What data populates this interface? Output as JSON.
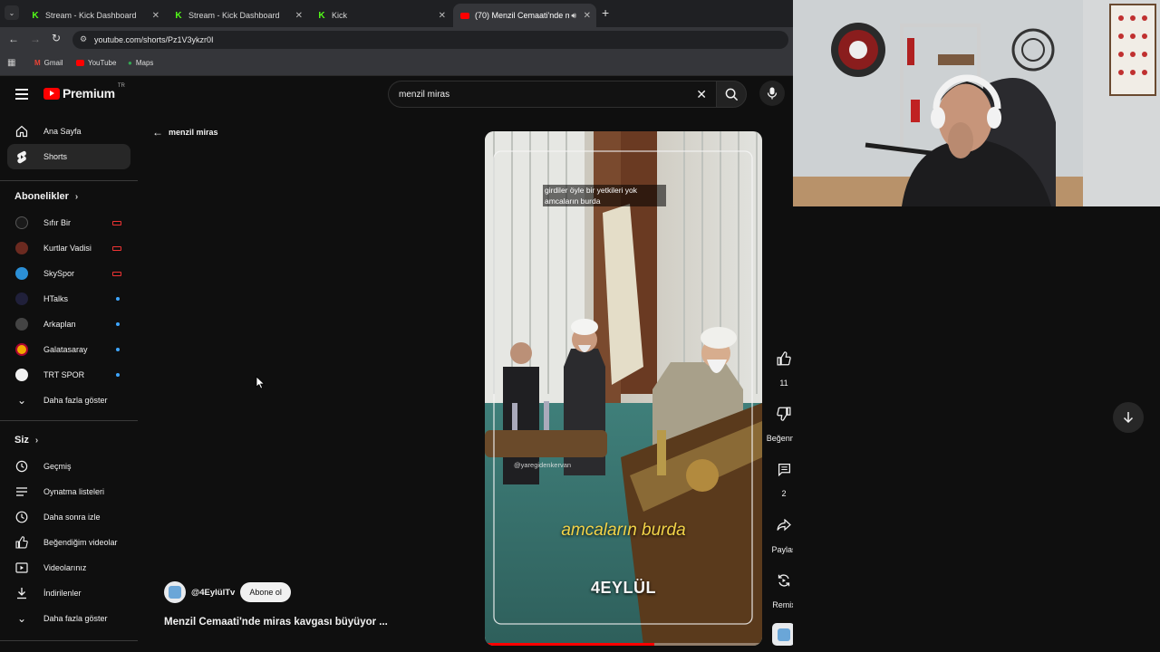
{
  "browser": {
    "tabs": [
      {
        "label": "Stream - Kick Dashboard"
      },
      {
        "label": "Stream - Kick Dashboard"
      },
      {
        "label": "Kick"
      },
      {
        "label": "(70) Menzil Cemaati'nde m"
      }
    ],
    "url": "youtube.com/shorts/Pz1V3ykzr0I",
    "bookmarks": [
      {
        "label": "Gmail"
      },
      {
        "label": "YouTube"
      },
      {
        "label": "Maps"
      }
    ]
  },
  "youtube": {
    "logo_text": "Premium",
    "logo_region": "TR",
    "search_value": "menzil miras",
    "back_label": "menzil miras",
    "nav": [
      {
        "label": "Ana Sayfa"
      },
      {
        "label": "Shorts"
      }
    ],
    "subscriptions_heading": "Abonelikler",
    "subscriptions": [
      {
        "label": "Sıfır Bir"
      },
      {
        "label": "Kurtlar Vadisi"
      },
      {
        "label": "SkySpor"
      },
      {
        "label": "HTalks"
      },
      {
        "label": "Arkaplan"
      },
      {
        "label": "Galatasaray"
      },
      {
        "label": "TRT SPOR"
      }
    ],
    "show_more_subs": "Daha fazla göster",
    "you_heading": "Siz",
    "you_items": [
      {
        "label": "Geçmiş"
      },
      {
        "label": "Oynatma listeleri"
      },
      {
        "label": "Daha sonra izle"
      },
      {
        "label": "Beğendiğim videolar"
      },
      {
        "label": "Videolarınız"
      },
      {
        "label": "İndirilenler"
      }
    ],
    "show_more_you": "Daha fazla göster",
    "short": {
      "caption_top": "girdiler öyle bir yetkileri yok amcaların burda",
      "watermark": "@yaregidenkervan",
      "subtitle": "amcaların burda",
      "brand": "4EYLÜL",
      "channel": "@4EylülTv",
      "subscribe_label": "Abone ol",
      "title": "Menzil Cemaati'nde miras kavgası büyüyor ...",
      "progress": 0.61
    },
    "actions": {
      "like_count": "11",
      "dislike_label": "Beğenme",
      "comment_count": "2",
      "share_label": "Paylaş",
      "remix_label": "Remix"
    }
  },
  "colors": {
    "yt_red": "#ff0000",
    "kick_green": "#53fc18",
    "accent_blue": "#3ea6ff"
  }
}
